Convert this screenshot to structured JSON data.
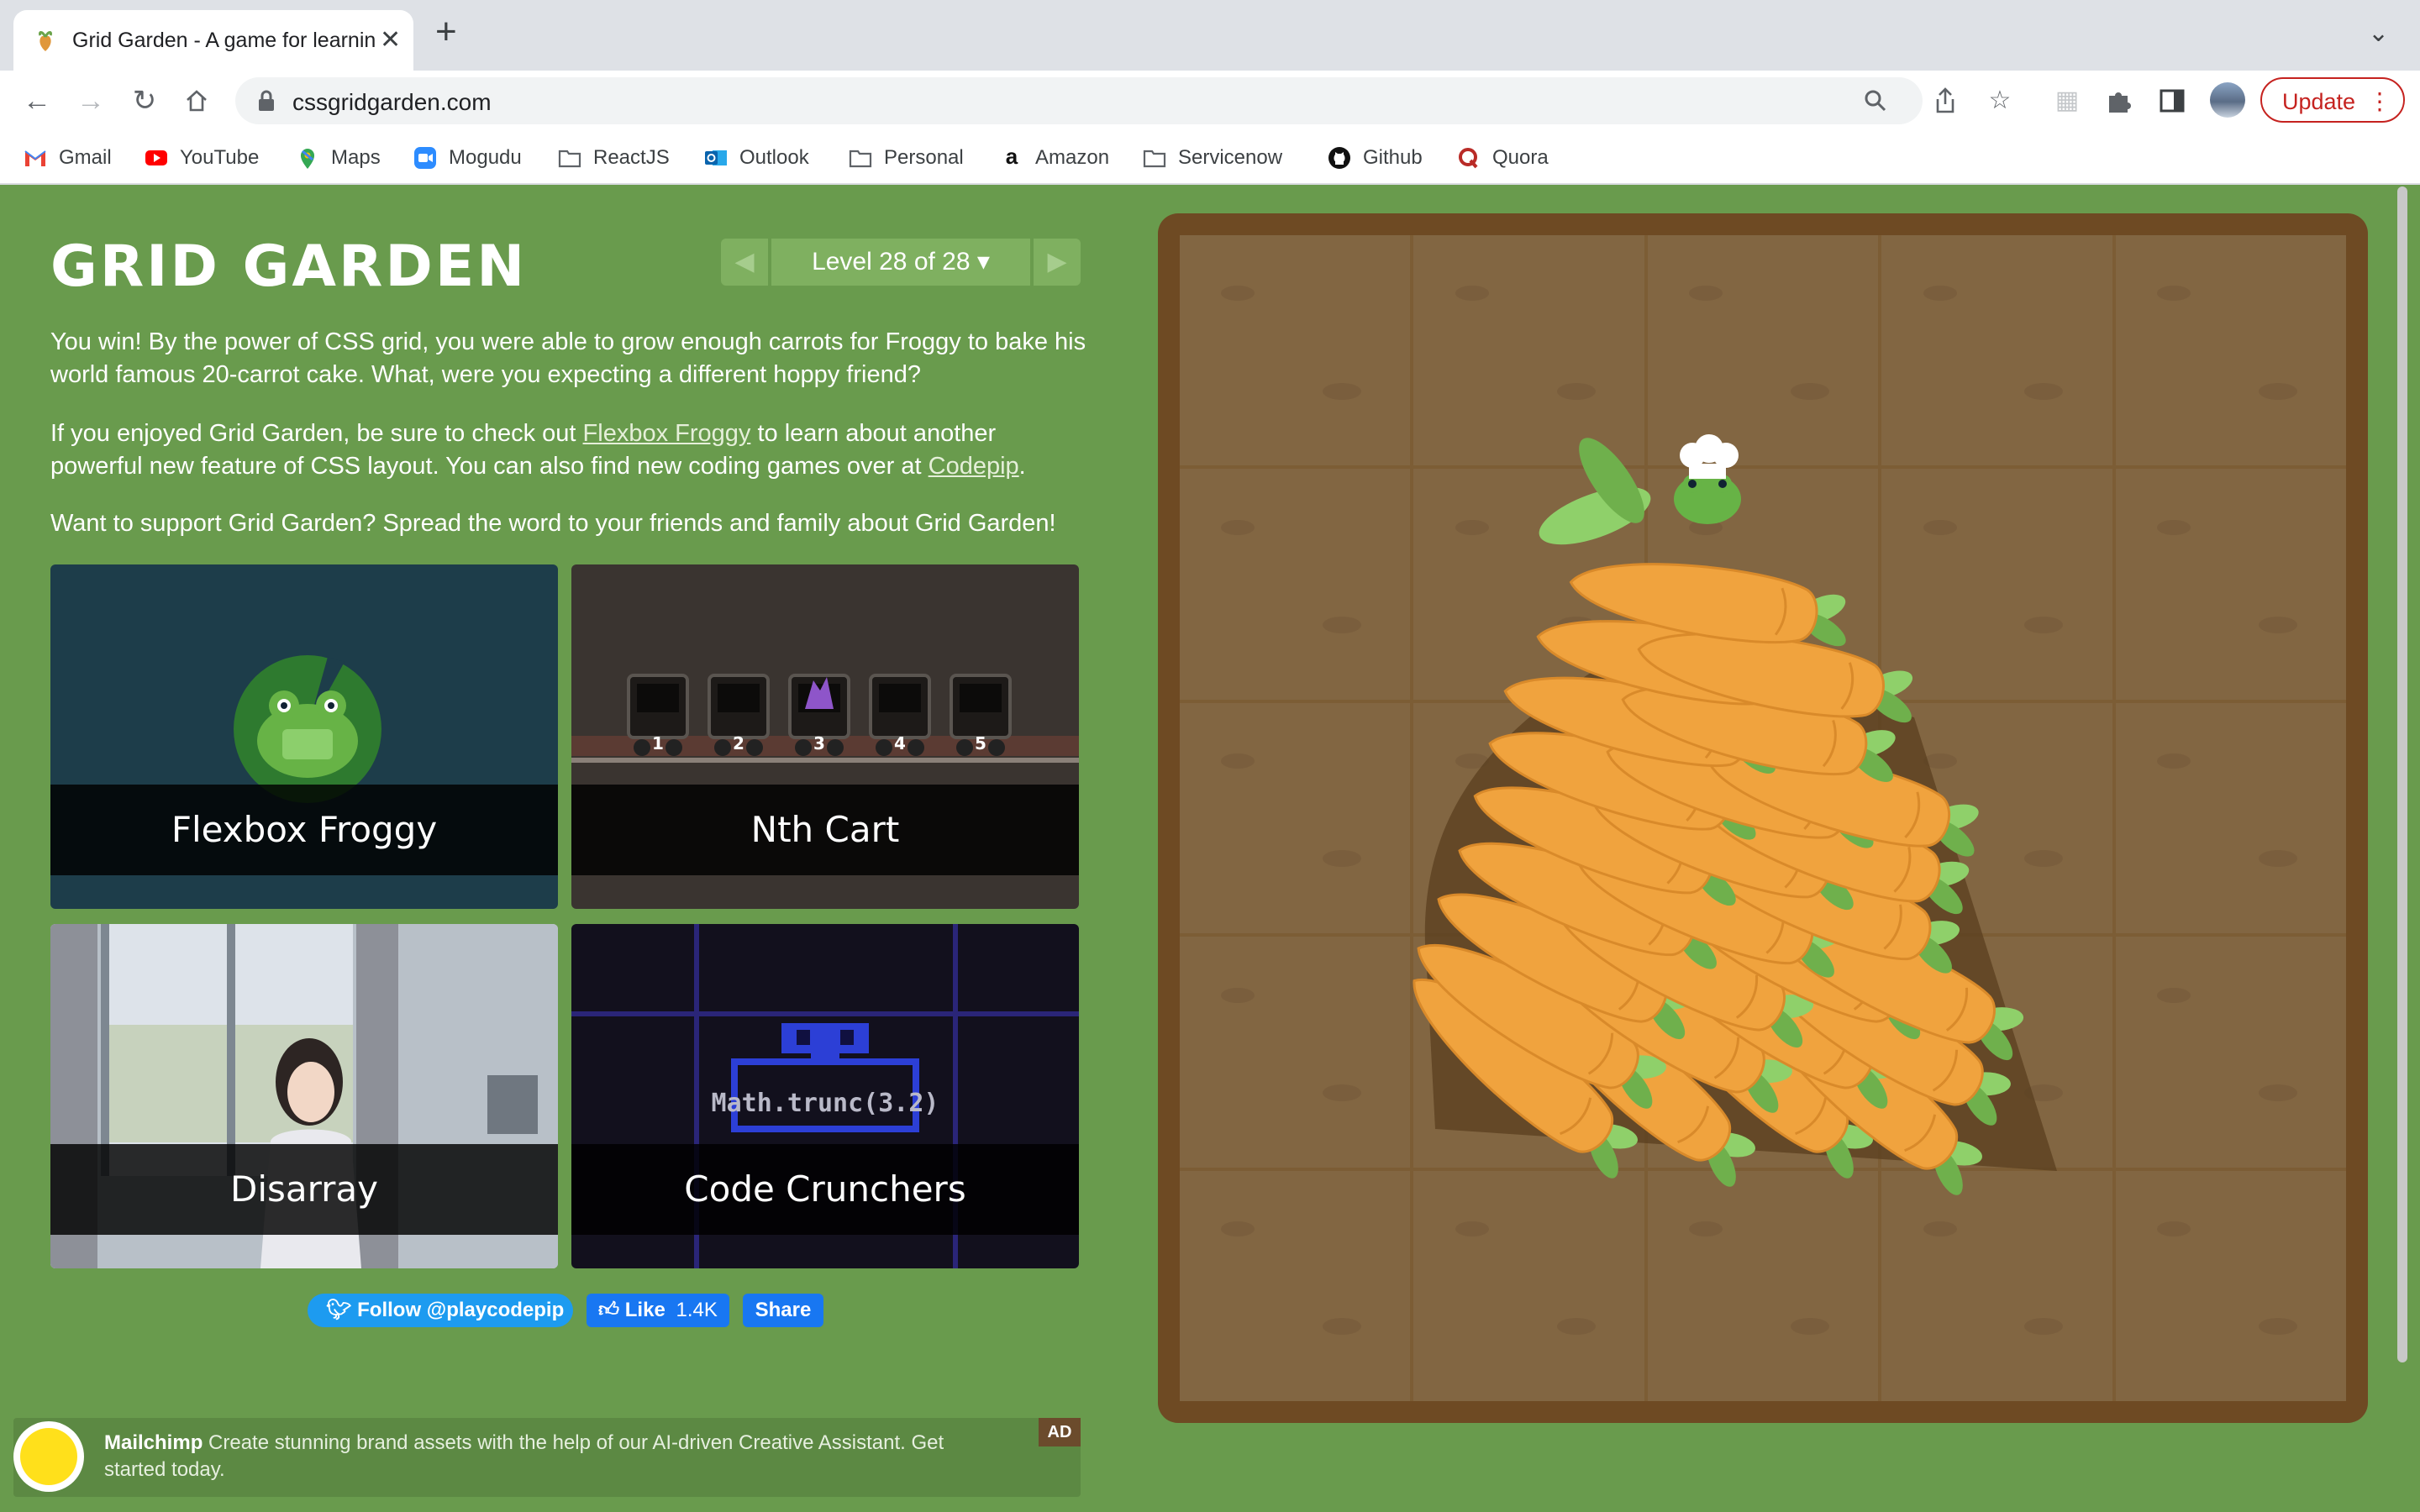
{
  "browser": {
    "tab_title": "Grid Garden - A game for learning CSS grid",
    "url": "cssgridgarden.com",
    "update_label": "Update",
    "bookmarks": [
      {
        "label": "Gmail",
        "icon": "gmail-icon"
      },
      {
        "label": "YouTube",
        "icon": "youtube-icon"
      },
      {
        "label": "Maps",
        "icon": "maps-icon"
      },
      {
        "label": "Mogudu",
        "icon": "zoom-icon"
      },
      {
        "label": "ReactJS",
        "icon": "folder-icon"
      },
      {
        "label": "Outlook",
        "icon": "outlook-icon"
      },
      {
        "label": "Personal",
        "icon": "folder-icon"
      },
      {
        "label": "Amazon",
        "icon": "amazon-icon"
      },
      {
        "label": "Servicenow",
        "icon": "folder-icon"
      },
      {
        "label": "Github",
        "icon": "github-icon"
      },
      {
        "label": "Quora",
        "icon": "quora-icon"
      }
    ]
  },
  "game": {
    "title": "GRID GARDEN",
    "level_label": "Level 28 of 28 ▾",
    "win_text": "You win! By the power of CSS grid, you were able to grow enough carrots for Froggy to bake his world famous 20-carrot cake. What, were you expecting a different hoppy friend?",
    "promo_pre": "If you enjoyed Grid Garden, be sure to check out ",
    "promo_link1": "Flexbox Froggy",
    "promo_mid": " to learn about another powerful new feature of CSS layout. You can also find new coding games over at ",
    "promo_link2": "Codepip",
    "promo_end": ".",
    "support_text": "Want to support Grid Garden? Spread the word to your friends and family about Grid Garden!",
    "cards": [
      {
        "label": "Flexbox Froggy"
      },
      {
        "label": "Nth Cart"
      },
      {
        "label": "Disarray"
      },
      {
        "label": "Code Crunchers"
      }
    ],
    "cart_numbers": [
      "1",
      "2",
      "3",
      "4",
      "5"
    ],
    "code_snippet": "Math.trunc(3.2)",
    "social": {
      "follow": "Follow @playcodepip",
      "like": "Like",
      "like_count": "1.4K",
      "share": "Share"
    },
    "ad": {
      "brand": "Mailchimp",
      "text": " Create stunning brand assets with the help of our AI-driven Creative Assistant. Get started today.",
      "tag": "AD"
    }
  },
  "colors": {
    "page_bg": "#699b4d",
    "garden_border": "#6e4a23",
    "soil": "#826642",
    "carrot": "#f0a33e",
    "leaf": "#8fd06a"
  }
}
